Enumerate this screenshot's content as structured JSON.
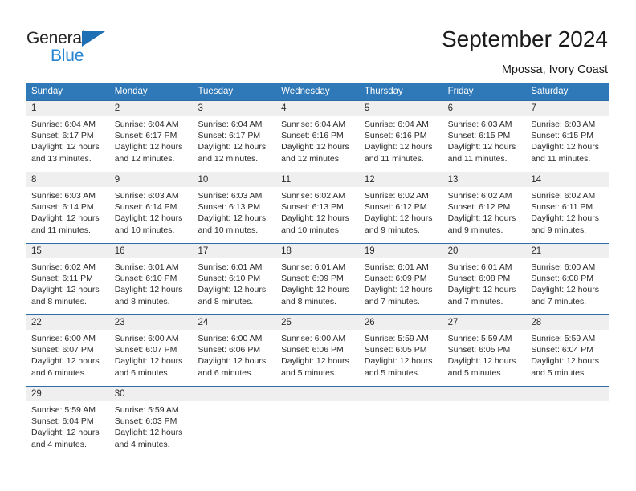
{
  "brand": {
    "name_part1": "General",
    "name_part2": "Blue",
    "accent_color": "#2585d3",
    "triangle_color": "#1f6fb5"
  },
  "header": {
    "title": "September 2024",
    "subtitle": "Mpossa, Ivory Coast"
  },
  "calendar": {
    "header_bg": "#3079b8",
    "daynum_bg": "#efefef",
    "weekdays": [
      "Sunday",
      "Monday",
      "Tuesday",
      "Wednesday",
      "Thursday",
      "Friday",
      "Saturday"
    ],
    "weeks": [
      [
        {
          "day": "1",
          "sunrise": "Sunrise: 6:04 AM",
          "sunset": "Sunset: 6:17 PM",
          "daylight1": "Daylight: 12 hours",
          "daylight2": "and 13 minutes."
        },
        {
          "day": "2",
          "sunrise": "Sunrise: 6:04 AM",
          "sunset": "Sunset: 6:17 PM",
          "daylight1": "Daylight: 12 hours",
          "daylight2": "and 12 minutes."
        },
        {
          "day": "3",
          "sunrise": "Sunrise: 6:04 AM",
          "sunset": "Sunset: 6:17 PM",
          "daylight1": "Daylight: 12 hours",
          "daylight2": "and 12 minutes."
        },
        {
          "day": "4",
          "sunrise": "Sunrise: 6:04 AM",
          "sunset": "Sunset: 6:16 PM",
          "daylight1": "Daylight: 12 hours",
          "daylight2": "and 12 minutes."
        },
        {
          "day": "5",
          "sunrise": "Sunrise: 6:04 AM",
          "sunset": "Sunset: 6:16 PM",
          "daylight1": "Daylight: 12 hours",
          "daylight2": "and 11 minutes."
        },
        {
          "day": "6",
          "sunrise": "Sunrise: 6:03 AM",
          "sunset": "Sunset: 6:15 PM",
          "daylight1": "Daylight: 12 hours",
          "daylight2": "and 11 minutes."
        },
        {
          "day": "7",
          "sunrise": "Sunrise: 6:03 AM",
          "sunset": "Sunset: 6:15 PM",
          "daylight1": "Daylight: 12 hours",
          "daylight2": "and 11 minutes."
        }
      ],
      [
        {
          "day": "8",
          "sunrise": "Sunrise: 6:03 AM",
          "sunset": "Sunset: 6:14 PM",
          "daylight1": "Daylight: 12 hours",
          "daylight2": "and 11 minutes."
        },
        {
          "day": "9",
          "sunrise": "Sunrise: 6:03 AM",
          "sunset": "Sunset: 6:14 PM",
          "daylight1": "Daylight: 12 hours",
          "daylight2": "and 10 minutes."
        },
        {
          "day": "10",
          "sunrise": "Sunrise: 6:03 AM",
          "sunset": "Sunset: 6:13 PM",
          "daylight1": "Daylight: 12 hours",
          "daylight2": "and 10 minutes."
        },
        {
          "day": "11",
          "sunrise": "Sunrise: 6:02 AM",
          "sunset": "Sunset: 6:13 PM",
          "daylight1": "Daylight: 12 hours",
          "daylight2": "and 10 minutes."
        },
        {
          "day": "12",
          "sunrise": "Sunrise: 6:02 AM",
          "sunset": "Sunset: 6:12 PM",
          "daylight1": "Daylight: 12 hours",
          "daylight2": "and 9 minutes."
        },
        {
          "day": "13",
          "sunrise": "Sunrise: 6:02 AM",
          "sunset": "Sunset: 6:12 PM",
          "daylight1": "Daylight: 12 hours",
          "daylight2": "and 9 minutes."
        },
        {
          "day": "14",
          "sunrise": "Sunrise: 6:02 AM",
          "sunset": "Sunset: 6:11 PM",
          "daylight1": "Daylight: 12 hours",
          "daylight2": "and 9 minutes."
        }
      ],
      [
        {
          "day": "15",
          "sunrise": "Sunrise: 6:02 AM",
          "sunset": "Sunset: 6:11 PM",
          "daylight1": "Daylight: 12 hours",
          "daylight2": "and 8 minutes."
        },
        {
          "day": "16",
          "sunrise": "Sunrise: 6:01 AM",
          "sunset": "Sunset: 6:10 PM",
          "daylight1": "Daylight: 12 hours",
          "daylight2": "and 8 minutes."
        },
        {
          "day": "17",
          "sunrise": "Sunrise: 6:01 AM",
          "sunset": "Sunset: 6:10 PM",
          "daylight1": "Daylight: 12 hours",
          "daylight2": "and 8 minutes."
        },
        {
          "day": "18",
          "sunrise": "Sunrise: 6:01 AM",
          "sunset": "Sunset: 6:09 PM",
          "daylight1": "Daylight: 12 hours",
          "daylight2": "and 8 minutes."
        },
        {
          "day": "19",
          "sunrise": "Sunrise: 6:01 AM",
          "sunset": "Sunset: 6:09 PM",
          "daylight1": "Daylight: 12 hours",
          "daylight2": "and 7 minutes."
        },
        {
          "day": "20",
          "sunrise": "Sunrise: 6:01 AM",
          "sunset": "Sunset: 6:08 PM",
          "daylight1": "Daylight: 12 hours",
          "daylight2": "and 7 minutes."
        },
        {
          "day": "21",
          "sunrise": "Sunrise: 6:00 AM",
          "sunset": "Sunset: 6:08 PM",
          "daylight1": "Daylight: 12 hours",
          "daylight2": "and 7 minutes."
        }
      ],
      [
        {
          "day": "22",
          "sunrise": "Sunrise: 6:00 AM",
          "sunset": "Sunset: 6:07 PM",
          "daylight1": "Daylight: 12 hours",
          "daylight2": "and 6 minutes."
        },
        {
          "day": "23",
          "sunrise": "Sunrise: 6:00 AM",
          "sunset": "Sunset: 6:07 PM",
          "daylight1": "Daylight: 12 hours",
          "daylight2": "and 6 minutes."
        },
        {
          "day": "24",
          "sunrise": "Sunrise: 6:00 AM",
          "sunset": "Sunset: 6:06 PM",
          "daylight1": "Daylight: 12 hours",
          "daylight2": "and 6 minutes."
        },
        {
          "day": "25",
          "sunrise": "Sunrise: 6:00 AM",
          "sunset": "Sunset: 6:06 PM",
          "daylight1": "Daylight: 12 hours",
          "daylight2": "and 5 minutes."
        },
        {
          "day": "26",
          "sunrise": "Sunrise: 5:59 AM",
          "sunset": "Sunset: 6:05 PM",
          "daylight1": "Daylight: 12 hours",
          "daylight2": "and 5 minutes."
        },
        {
          "day": "27",
          "sunrise": "Sunrise: 5:59 AM",
          "sunset": "Sunset: 6:05 PM",
          "daylight1": "Daylight: 12 hours",
          "daylight2": "and 5 minutes."
        },
        {
          "day": "28",
          "sunrise": "Sunrise: 5:59 AM",
          "sunset": "Sunset: 6:04 PM",
          "daylight1": "Daylight: 12 hours",
          "daylight2": "and 5 minutes."
        }
      ],
      [
        {
          "day": "29",
          "sunrise": "Sunrise: 5:59 AM",
          "sunset": "Sunset: 6:04 PM",
          "daylight1": "Daylight: 12 hours",
          "daylight2": "and 4 minutes."
        },
        {
          "day": "30",
          "sunrise": "Sunrise: 5:59 AM",
          "sunset": "Sunset: 6:03 PM",
          "daylight1": "Daylight: 12 hours",
          "daylight2": "and 4 minutes."
        },
        {
          "day": "",
          "sunrise": "",
          "sunset": "",
          "daylight1": "",
          "daylight2": ""
        },
        {
          "day": "",
          "sunrise": "",
          "sunset": "",
          "daylight1": "",
          "daylight2": ""
        },
        {
          "day": "",
          "sunrise": "",
          "sunset": "",
          "daylight1": "",
          "daylight2": ""
        },
        {
          "day": "",
          "sunrise": "",
          "sunset": "",
          "daylight1": "",
          "daylight2": ""
        },
        {
          "day": "",
          "sunrise": "",
          "sunset": "",
          "daylight1": "",
          "daylight2": ""
        }
      ]
    ]
  }
}
